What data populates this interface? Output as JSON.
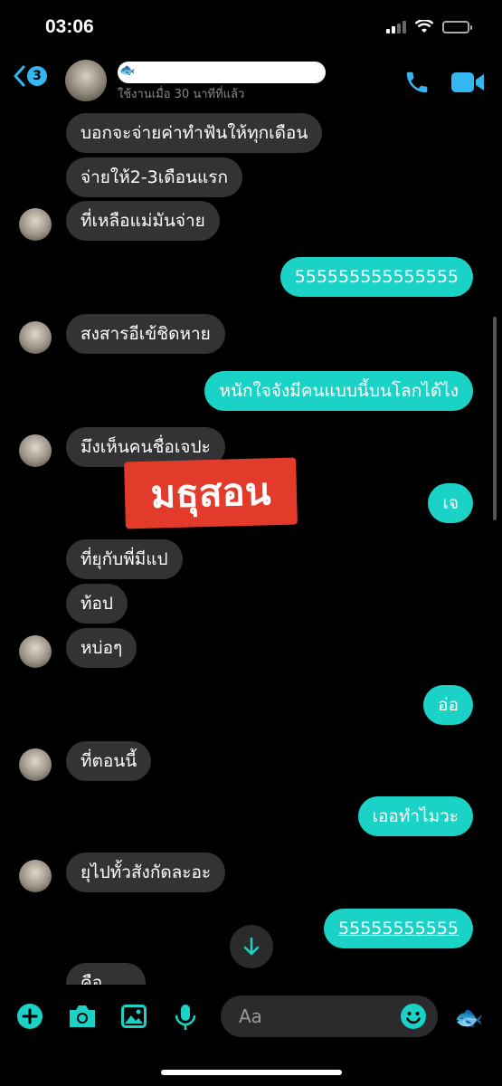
{
  "status_bar": {
    "time": "03:06"
  },
  "header": {
    "back_badge": "3",
    "subtitle": "ใช้งานเมื่อ 30 นาทีที่แล้ว"
  },
  "messages": {
    "m1": "บอกจะจ่ายค่าทำฟันให้ทุกเดือน",
    "m2": "จ่ายให้2-3เดือนแรก",
    "m3": "ที่เหลือแม่มันจ่าย",
    "m4": "555555555555555",
    "m5": "สงสารอีเข้ชิดหาย",
    "m6": "หนักใจจังมีคนแบบนี้บนโลกได้ไง",
    "m7": "มึงเห็นคนชื่อเจปะ",
    "m8": "เจ",
    "m9": "ที่ยุกับพี่มีแป",
    "m10": "ท้อป",
    "m11": "หบ่อๆ",
    "m12": "อ่อ",
    "m13": "ที่ตอนนี้",
    "m14": "เออทำไมวะ",
    "m15": "ยุไปทั้วสังกัดละอะ",
    "m16": "55555555555",
    "m17": "คือ"
  },
  "sticker": {
    "text": "มธุสอน"
  },
  "composer": {
    "placeholder": "Aa"
  },
  "colors": {
    "accent": "#34b7f1",
    "outgoing_bubble": "#1bd2c6",
    "incoming_bubble": "#333336",
    "sticker": "#e23b2c"
  },
  "icons": [
    "back-chevron-icon",
    "phone-icon",
    "video-camera-icon",
    "plus-icon",
    "camera-icon",
    "image-icon",
    "microphone-icon",
    "smiley-icon",
    "fish-emoji-icon",
    "arrow-down-icon"
  ]
}
